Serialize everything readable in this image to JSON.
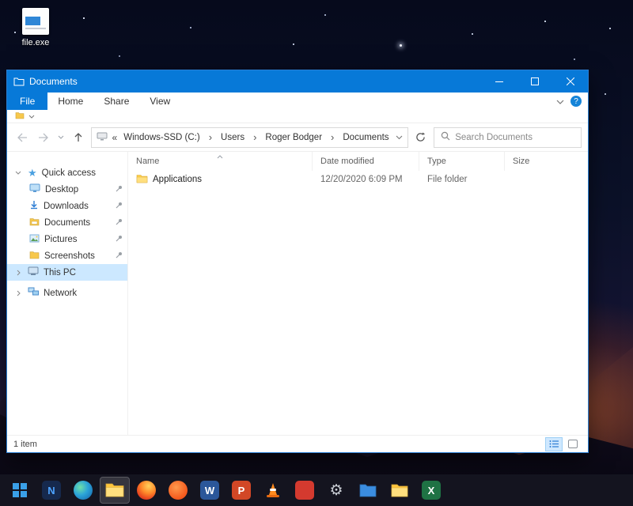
{
  "desktop": {
    "file_label": "file.exe"
  },
  "explorer": {
    "title": "Documents",
    "menu": {
      "file": "File",
      "tabs": [
        "Home",
        "Share",
        "View"
      ],
      "help_glyph": "?"
    },
    "address": {
      "collapsed_glyph": "«",
      "separator": "›",
      "segments": [
        "Windows-SSD (C:)",
        "Users",
        "Roger Bodger",
        "Documents"
      ]
    },
    "search": {
      "placeholder": "Search Documents"
    },
    "sidebar": {
      "quick_access": "Quick access",
      "items": [
        {
          "label": "Desktop",
          "pinned": true
        },
        {
          "label": "Downloads",
          "pinned": true
        },
        {
          "label": "Documents",
          "pinned": true
        },
        {
          "label": "Pictures",
          "pinned": true
        },
        {
          "label": "Screenshots",
          "pinned": true
        }
      ],
      "this_pc": "This PC",
      "network": "Network"
    },
    "columns": [
      "Name",
      "Date modified",
      "Type",
      "Size"
    ],
    "files": [
      {
        "name": "Applications",
        "date_modified": "12/20/2020 6:09 PM",
        "type": "File folder",
        "size": ""
      }
    ],
    "status": "1 item"
  },
  "icons": {
    "star": "★",
    "gear": "⚙"
  },
  "taskbar": {
    "apps": [
      {
        "name": "start"
      },
      {
        "name": "app-n",
        "glyph": "N"
      },
      {
        "name": "edge"
      },
      {
        "name": "file-explorer",
        "active": true
      },
      {
        "name": "firefox"
      },
      {
        "name": "app-orange"
      },
      {
        "name": "word",
        "glyph": "W"
      },
      {
        "name": "powerpoint",
        "glyph": "P"
      },
      {
        "name": "vlc"
      },
      {
        "name": "app-red"
      },
      {
        "name": "settings"
      },
      {
        "name": "app-blue"
      },
      {
        "name": "folder"
      },
      {
        "name": "excel",
        "glyph": "X"
      }
    ]
  }
}
